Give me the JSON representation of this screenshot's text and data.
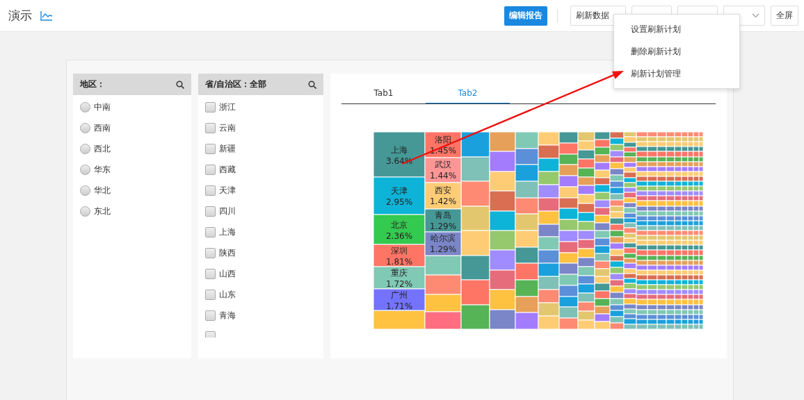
{
  "header": {
    "title": "演示",
    "edit_button": "编辑报告",
    "buttons": [
      {
        "kind": "split",
        "label": "刷新数据"
      },
      {
        "kind": "covered"
      },
      {
        "kind": "covered"
      },
      {
        "kind": "caret"
      },
      {
        "kind": "text",
        "label": "全屏"
      }
    ]
  },
  "refresh_menu": {
    "items": [
      "设置刷新计划",
      "删除刷新计划",
      "刷新计划管理"
    ]
  },
  "region_filter": {
    "title": "地区：",
    "items": [
      {
        "label": "中南",
        "selected": false
      },
      {
        "label": "西南",
        "selected": false
      },
      {
        "label": "西北",
        "selected": false
      },
      {
        "label": "华东",
        "selected": false
      },
      {
        "label": "华北",
        "selected": false
      },
      {
        "label": "东北",
        "selected": false
      }
    ]
  },
  "province_filter": {
    "title": "省/自治区：全部",
    "items": [
      {
        "label": "浙江",
        "checked": false
      },
      {
        "label": "云南",
        "checked": false
      },
      {
        "label": "新疆",
        "checked": false
      },
      {
        "label": "西藏",
        "checked": false
      },
      {
        "label": "天津",
        "checked": false
      },
      {
        "label": "四川",
        "checked": false
      },
      {
        "label": "上海",
        "checked": false
      },
      {
        "label": "陕西",
        "checked": false
      },
      {
        "label": "山西",
        "checked": false
      },
      {
        "label": "山东",
        "checked": false
      },
      {
        "label": "青海",
        "checked": false
      },
      {
        "checked": false
      }
    ]
  },
  "tabs": [
    {
      "label": "Tab1",
      "selected": false
    },
    {
      "label": "Tab2",
      "selected": true
    }
  ],
  "treemap": {
    "columns": [
      [
        {
          "name": "上海",
          "value": "3.64%",
          "color": "#459896"
        },
        {
          "name": "天津",
          "value": "2.95%",
          "color": "#0eb3d8"
        },
        {
          "name": "北京",
          "value": "2.36%",
          "color": "#34c94f"
        },
        {
          "name": "深圳",
          "value": "1.81%",
          "color": "#fe7566"
        },
        {
          "name": "重庆",
          "value": "1.72%",
          "color": "#80c9b4"
        },
        {
          "name": "广州",
          "value": "1.71%",
          "color": "#7373fe"
        }
      ],
      [
        {
          "name": "洛阳",
          "value": "1.45%",
          "color": "#fe7566"
        },
        {
          "name": "武汉",
          "value": "1.44%",
          "color": "#fe9696"
        },
        {
          "name": "西安",
          "value": "1.42%",
          "color": "#fdcc74"
        },
        {
          "name": "青岛",
          "value": "1.29%",
          "color": "#459896"
        },
        {
          "name": "哈尔滨",
          "value": "1.29%",
          "color": "#7b86c8"
        }
      ]
    ]
  }
}
